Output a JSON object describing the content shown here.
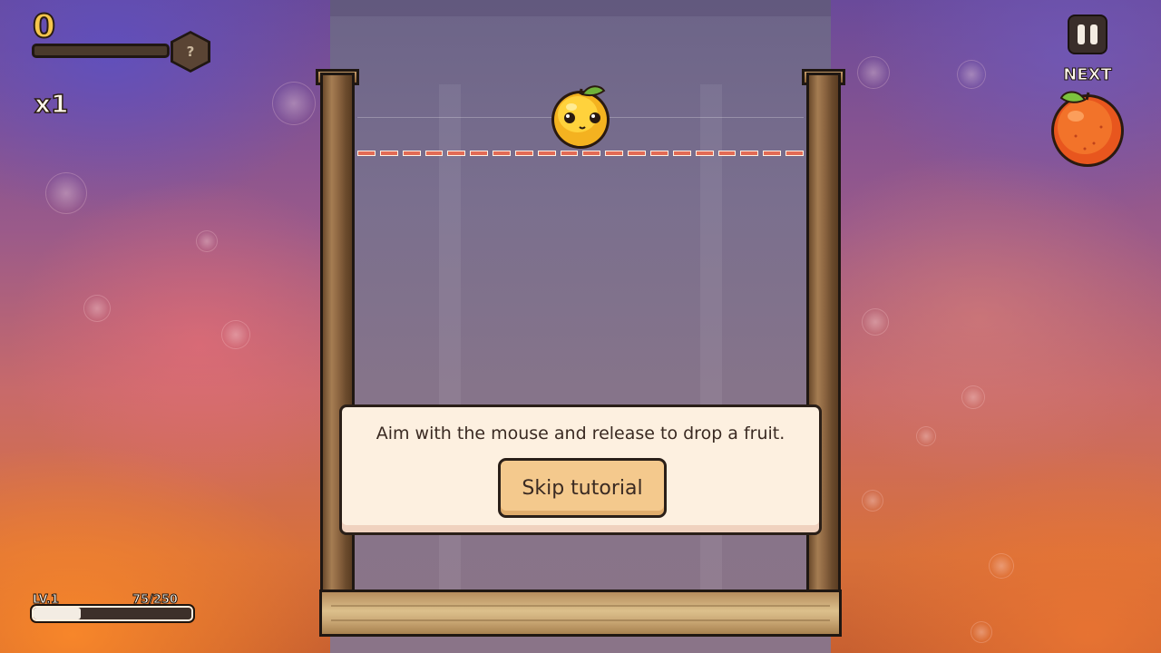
{
  "hud": {
    "score": "0",
    "score_progress": 0,
    "mystery_label": "?",
    "multiplier": "x1",
    "next_label": "NEXT",
    "next_fruit": "orange"
  },
  "board": {
    "current_fruit": "lemon"
  },
  "tutorial": {
    "message": "Aim with the mouse and release to drop a fruit.",
    "skip_label": "Skip tutorial"
  },
  "level": {
    "label": "LV.1",
    "xp_text": "75/250",
    "xp_current": 75,
    "xp_max": 250
  },
  "icons": {
    "pause": "pause-icon",
    "hex": "mystery-fruit-icon"
  },
  "colors": {
    "score": "#f6c64d",
    "drop_line": "#e26b55",
    "card_bg": "#fdf0e0",
    "button_bg": "#f4c98d"
  }
}
